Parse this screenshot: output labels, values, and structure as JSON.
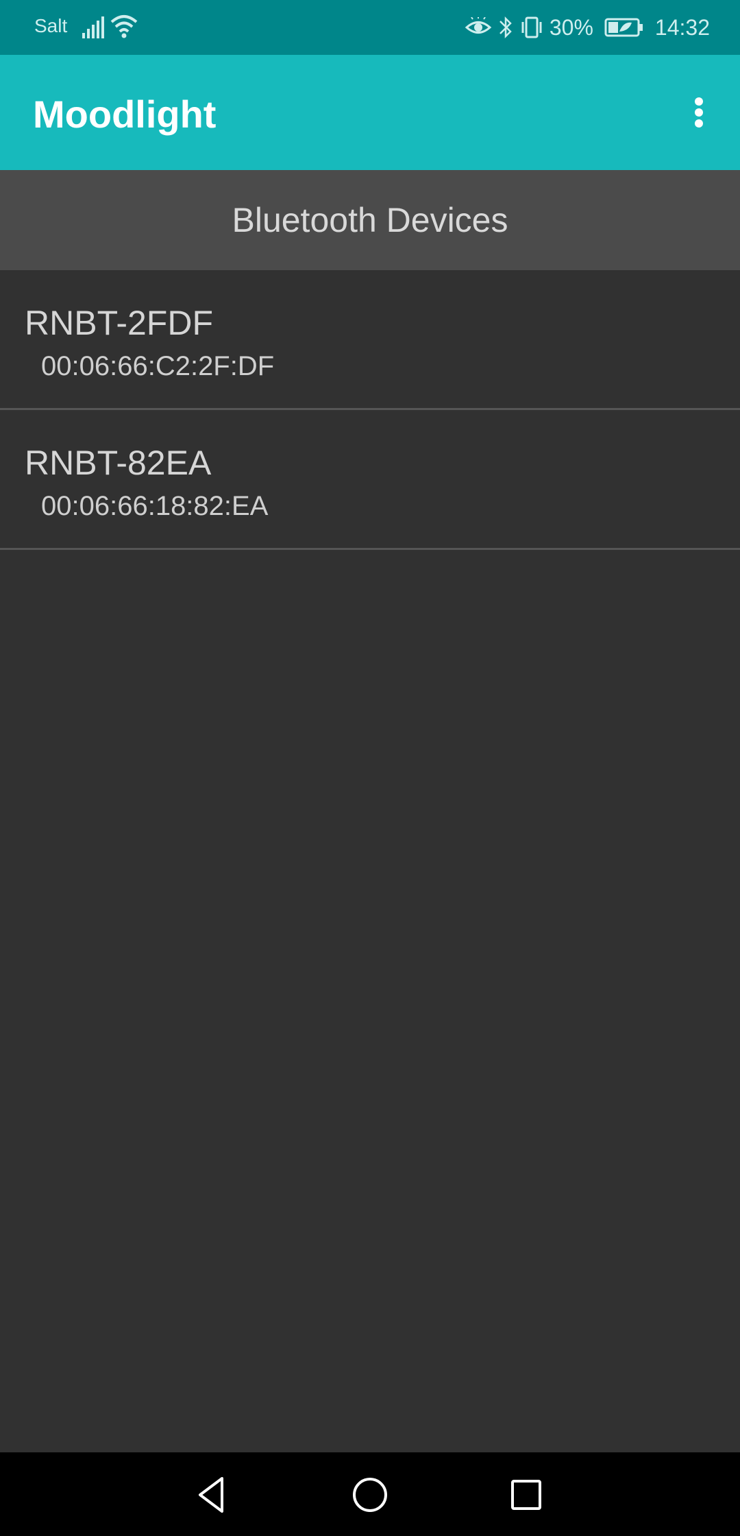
{
  "status_bar": {
    "carrier": "Salt",
    "battery_percent": "30%",
    "time": "14:32",
    "icons": [
      "signal-icon",
      "wifi-icon",
      "eye-comfort-icon",
      "bluetooth-icon",
      "vibrate-icon",
      "battery-icon"
    ]
  },
  "app_bar": {
    "title": "Moodlight",
    "overflow_icon": "more-vert-icon"
  },
  "section": {
    "title": "Bluetooth Devices"
  },
  "devices": [
    {
      "name": "RNBT-2FDF",
      "address": "00:06:66:C2:2F:DF"
    },
    {
      "name": "RNBT-82EA",
      "address": "00:06:66:18:82:EA"
    }
  ],
  "nav_bar": {
    "icons": [
      "back-icon",
      "home-icon",
      "recents-icon"
    ]
  },
  "colors": {
    "status_bar": "#00868A",
    "app_bar": "#17BABC",
    "section_header": "#4B4B4B",
    "background": "#313131"
  }
}
